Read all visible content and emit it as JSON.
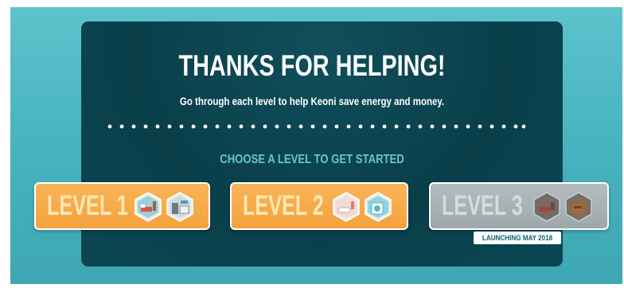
{
  "title": "THANKS FOR HELPING!",
  "subtitle": "Go through each level to help Keoni save energy and money.",
  "choose_prompt": "CHOOSE A LEVEL TO GET STARTED",
  "levels": [
    {
      "label": "LEVEL 1",
      "state": "unlocked",
      "rooms": [
        "bedroom",
        "kitchen"
      ]
    },
    {
      "label": "LEVEL 2",
      "state": "unlocked",
      "rooms": [
        "bathroom",
        "laundry"
      ]
    },
    {
      "label": "LEVEL 3",
      "state": "locked",
      "rooms": [
        "living-room",
        "garage"
      ],
      "note": "LAUNCHING MAY 2018"
    }
  ],
  "colors": {
    "background": "#4bb6c0",
    "panel": "#0a3f4a",
    "accent_text": "#64c7d0",
    "level_button": "#f5a642",
    "level_label": "#ffe7b3",
    "locked_button": "#a7b0b4"
  }
}
